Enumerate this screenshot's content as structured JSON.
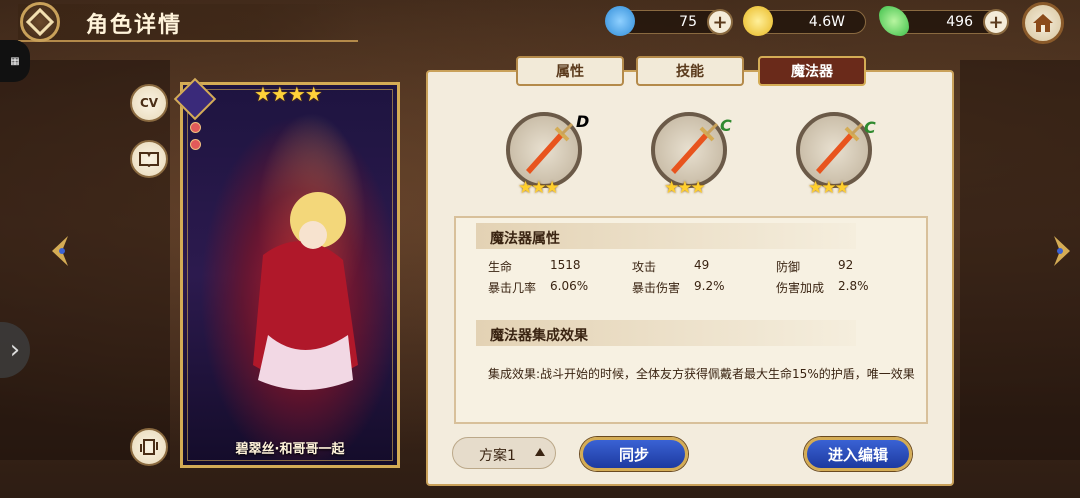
{
  "header": {
    "title": "角色详情"
  },
  "resources": [
    {
      "name": "energy",
      "value": "75",
      "icon": "blue-drop-icon",
      "color": "#2f8cd8"
    },
    {
      "name": "gold",
      "value": "4.6W",
      "icon": "gold-coin-icon",
      "color": "#e8b720"
    },
    {
      "name": "gems",
      "value": "496",
      "icon": "green-crystal-icon",
      "color": "#3ec04a"
    }
  ],
  "left_buttons": {
    "cv": "CV",
    "book": "book-icon",
    "flip": "card-flip-icon"
  },
  "card": {
    "stars": "★★★★",
    "name": "碧翠丝·和哥哥一起"
  },
  "tabs": [
    {
      "label": "属性",
      "active": false
    },
    {
      "label": "技能",
      "active": false
    },
    {
      "label": "魔法器",
      "active": true
    }
  ],
  "magic_items": [
    {
      "grade": "D",
      "stars": "★★★",
      "grade_color": "#2a2a2a"
    },
    {
      "grade": "C",
      "stars": "★★★",
      "grade_color": "#2f8a2f"
    },
    {
      "grade": "C",
      "stars": "★★★",
      "grade_color": "#2f8a2f"
    }
  ],
  "attributes": {
    "title": "魔法器属性",
    "rows": [
      [
        {
          "label": "生命",
          "value": "1518"
        },
        {
          "label": "攻击",
          "value": "49"
        },
        {
          "label": "防御",
          "value": "92"
        }
      ],
      [
        {
          "label": "暴击几率",
          "value": "6.06%"
        },
        {
          "label": "暴击伤害",
          "value": "9.2%"
        },
        {
          "label": "伤害加成",
          "value": "2.8%"
        }
      ]
    ]
  },
  "set_effect": {
    "title": "魔法器集成效果",
    "text": "集成效果:战斗开始的时候，全体友方获得佩戴者最大生命15%的护盾，唯一效果"
  },
  "footer": {
    "scheme": "方案1",
    "sync": "同步",
    "edit": "进入编辑"
  }
}
